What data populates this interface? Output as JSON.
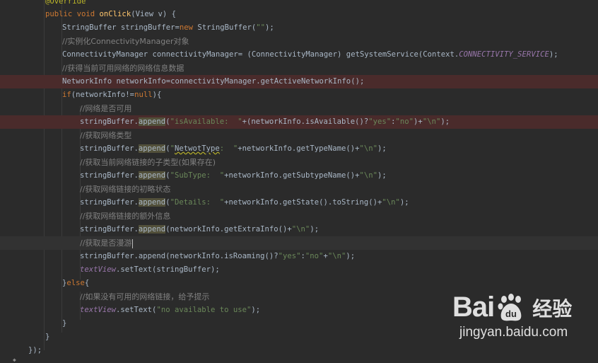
{
  "editor": {
    "lines": [
      {
        "tokens": [
          {
            "t": "ann",
            "v": "@Override"
          }
        ]
      },
      {
        "tokens": [
          {
            "t": "kw",
            "v": "public void "
          },
          {
            "t": "fn",
            "v": "onClick"
          },
          {
            "t": "",
            "v": "(View v) {"
          }
        ]
      },
      {
        "tokens": [
          {
            "t": "",
            "v": "StringBuffer stringBuffer="
          },
          {
            "t": "kw",
            "v": "new "
          },
          {
            "t": "",
            "v": "StringBuffer("
          },
          {
            "t": "str",
            "v": "\"\""
          },
          {
            "t": "",
            "v": ");"
          }
        ]
      },
      {
        "tokens": [
          {
            "t": "cmt",
            "v": "//实例化ConnectivityManager对象"
          }
        ]
      },
      {
        "tokens": [
          {
            "t": "",
            "v": "ConnectivityManager connectivityManager= (ConnectivityManager) getSystemService(Context."
          },
          {
            "t": "const",
            "v": "CONNECTIVITY_SERVICE"
          },
          {
            "t": "",
            "v": ");"
          }
        ]
      },
      {
        "tokens": [
          {
            "t": "cmt",
            "v": "//获得当前可用网络的网络信息数据"
          }
        ]
      },
      {
        "tokens": [
          {
            "t": "",
            "v": "NetworkInfo networkInfo=connectivityManager.getActiveNetworkInfo();"
          }
        ]
      },
      {
        "tokens": [
          {
            "t": "kw",
            "v": "if"
          },
          {
            "t": "",
            "v": "(networkInfo!="
          },
          {
            "t": "kw",
            "v": "null"
          },
          {
            "t": "",
            "v": "){"
          }
        ]
      },
      {
        "tokens": [
          {
            "t": "cmt",
            "v": "//网络是否可用"
          }
        ]
      },
      {
        "tokens": [
          {
            "t": "",
            "v": "stringBuffer."
          },
          {
            "t": "hl",
            "v": "append"
          },
          {
            "t": "",
            "v": "("
          },
          {
            "t": "str",
            "v": "\"isAvailable:  \""
          },
          {
            "t": "",
            "v": "+(networkInfo.isAvailable()?"
          },
          {
            "t": "str",
            "v": "\"yes\""
          },
          {
            "t": "",
            "v": ":"
          },
          {
            "t": "str",
            "v": "\"no\""
          },
          {
            "t": "",
            "v": ")+"
          },
          {
            "t": "str",
            "v": "\"\\n\""
          },
          {
            "t": "",
            "v": ");"
          }
        ]
      },
      {
        "tokens": [
          {
            "t": "cmt",
            "v": "//获取网络类型"
          }
        ]
      },
      {
        "tokens": [
          {
            "t": "",
            "v": "stringBuffer."
          },
          {
            "t": "hl",
            "v": "append"
          },
          {
            "t": "",
            "v": "("
          },
          {
            "t": "str",
            "v": "\""
          },
          {
            "t": "warn",
            "v": "NetwotType"
          },
          {
            "t": "str",
            "v": ":  \""
          },
          {
            "t": "",
            "v": "+networkInfo.getTypeName()+"
          },
          {
            "t": "str",
            "v": "\"\\n\""
          },
          {
            "t": "",
            "v": ");"
          }
        ]
      },
      {
        "tokens": [
          {
            "t": "cmt",
            "v": "//获取当前网络链接的子类型(如果存在)"
          }
        ]
      },
      {
        "tokens": [
          {
            "t": "",
            "v": "stringBuffer."
          },
          {
            "t": "hl",
            "v": "append"
          },
          {
            "t": "",
            "v": "("
          },
          {
            "t": "str",
            "v": "\"SubType:  \""
          },
          {
            "t": "",
            "v": "+networkInfo.getSubtypeName()+"
          },
          {
            "t": "str",
            "v": "\"\\n\""
          },
          {
            "t": "",
            "v": ");"
          }
        ]
      },
      {
        "tokens": [
          {
            "t": "cmt",
            "v": "//获取网络链接的初略状态"
          }
        ]
      },
      {
        "tokens": [
          {
            "t": "",
            "v": "stringBuffer."
          },
          {
            "t": "hl",
            "v": "append"
          },
          {
            "t": "",
            "v": "("
          },
          {
            "t": "str",
            "v": "\"Details:  \""
          },
          {
            "t": "",
            "v": "+networkInfo.getState().toString()+"
          },
          {
            "t": "str",
            "v": "\"\\n\""
          },
          {
            "t": "",
            "v": ");"
          }
        ]
      },
      {
        "tokens": [
          {
            "t": "cmt",
            "v": "//获取网络链接的额外信息"
          }
        ]
      },
      {
        "tokens": [
          {
            "t": "",
            "v": "stringBuffer."
          },
          {
            "t": "hl",
            "v": "append"
          },
          {
            "t": "",
            "v": "(networkInfo.getExtraInfo()+"
          },
          {
            "t": "str",
            "v": "\"\\n\""
          },
          {
            "t": "",
            "v": ");"
          }
        ]
      },
      {
        "tokens": [
          {
            "t": "cmt",
            "v": "//获取是否漫游"
          }
        ]
      },
      {
        "tokens": [
          {
            "t": "",
            "v": "stringBuffer.append(networkInfo.isRoaming()?"
          },
          {
            "t": "str",
            "v": "\"yes\""
          },
          {
            "t": "",
            "v": ":"
          },
          {
            "t": "str",
            "v": "\"no\""
          },
          {
            "t": "",
            "v": "+"
          },
          {
            "t": "str",
            "v": "\"\\n\""
          },
          {
            "t": "",
            "v": ");"
          }
        ]
      },
      {
        "tokens": [
          {
            "t": "const",
            "v": "textView"
          },
          {
            "t": "",
            "v": ".setText(stringBuffer);"
          }
        ]
      },
      {
        "tokens": [
          {
            "t": "",
            "v": "}"
          },
          {
            "t": "kw",
            "v": "else"
          },
          {
            "t": "",
            "v": "{"
          }
        ]
      },
      {
        "tokens": [
          {
            "t": "cmt",
            "v": "//如果没有可用的网络链接，给予提示"
          }
        ]
      },
      {
        "tokens": [
          {
            "t": "const",
            "v": "textView"
          },
          {
            "t": "",
            "v": ".setText("
          },
          {
            "t": "str",
            "v": "\"no available to use\""
          },
          {
            "t": "",
            "v": ");"
          }
        ]
      },
      {
        "tokens": [
          {
            "t": "",
            "v": "}"
          }
        ]
      },
      {
        "tokens": [
          {
            "t": "",
            "v": "}"
          }
        ]
      },
      {
        "tokens": [
          {
            "t": "",
            "v": "});"
          }
        ]
      }
    ]
  },
  "watermark": {
    "brand_prefix": "Bai",
    "brand_suffix": "经验",
    "paw_letter": "du",
    "url": "jingyan.baidu.com"
  }
}
